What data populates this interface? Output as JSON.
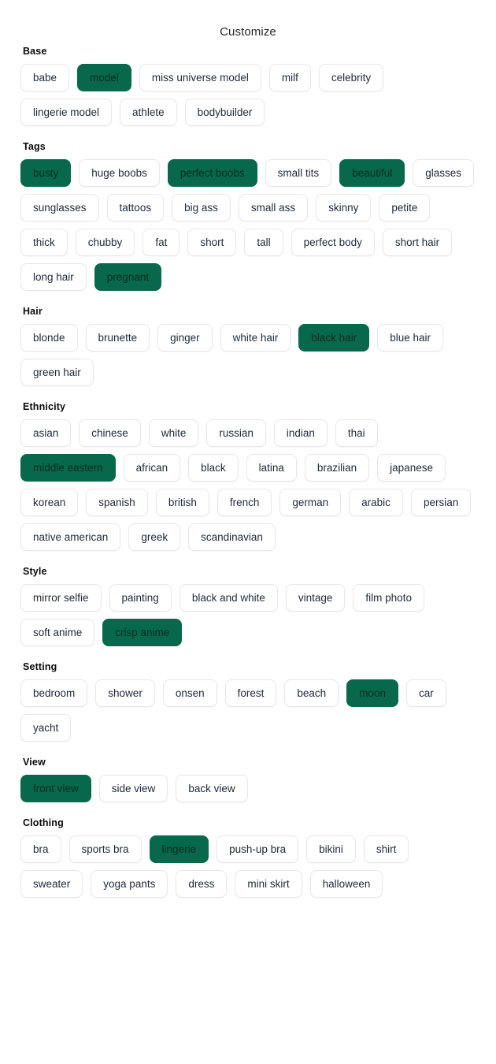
{
  "panel": {
    "title": "Customize",
    "accent_selected_bg": "#07684B",
    "accent_selected_text": "#0c2b20",
    "pill_bg": "#ffffff",
    "pill_border": "#e7e7ea",
    "pill_text": "#1f2937"
  },
  "sections": [
    {
      "label": "Base",
      "options": [
        {
          "label": "babe",
          "selected": false
        },
        {
          "label": "model",
          "selected": true
        },
        {
          "label": "miss universe model",
          "selected": false
        },
        {
          "label": "milf",
          "selected": false
        },
        {
          "label": "celebrity",
          "selected": false
        },
        {
          "label": "lingerie model",
          "selected": false
        },
        {
          "label": "athlete",
          "selected": false
        },
        {
          "label": "bodybuilder",
          "selected": false
        }
      ]
    },
    {
      "label": "Tags",
      "options": [
        {
          "label": "busty",
          "selected": true
        },
        {
          "label": "huge boobs",
          "selected": false
        },
        {
          "label": "perfect boobs",
          "selected": true
        },
        {
          "label": "small tits",
          "selected": false
        },
        {
          "label": "beautiful",
          "selected": true
        },
        {
          "label": "glasses",
          "selected": false
        },
        {
          "label": "sunglasses",
          "selected": false
        },
        {
          "label": "tattoos",
          "selected": false
        },
        {
          "label": "big ass",
          "selected": false
        },
        {
          "label": "small ass",
          "selected": false
        },
        {
          "label": "skinny",
          "selected": false
        },
        {
          "label": "petite",
          "selected": false
        },
        {
          "label": "thick",
          "selected": false
        },
        {
          "label": "chubby",
          "selected": false
        },
        {
          "label": "fat",
          "selected": false
        },
        {
          "label": "short",
          "selected": false
        },
        {
          "label": "tall",
          "selected": false
        },
        {
          "label": "perfect body",
          "selected": false
        },
        {
          "label": "short hair",
          "selected": false
        },
        {
          "label": "long hair",
          "selected": false
        },
        {
          "label": "pregnant",
          "selected": true
        }
      ]
    },
    {
      "label": "Hair",
      "options": [
        {
          "label": "blonde",
          "selected": false
        },
        {
          "label": "brunette",
          "selected": false
        },
        {
          "label": "ginger",
          "selected": false
        },
        {
          "label": "white hair",
          "selected": false
        },
        {
          "label": "black hair",
          "selected": true
        },
        {
          "label": "blue hair",
          "selected": false
        },
        {
          "label": "green hair",
          "selected": false
        }
      ]
    },
    {
      "label": "Ethnicity",
      "options": [
        {
          "label": "asian",
          "selected": false
        },
        {
          "label": "chinese",
          "selected": false
        },
        {
          "label": "white",
          "selected": false
        },
        {
          "label": "russian",
          "selected": false
        },
        {
          "label": "indian",
          "selected": false
        },
        {
          "label": "thai",
          "selected": false
        },
        {
          "label": "middle eastern",
          "selected": true
        },
        {
          "label": "african",
          "selected": false
        },
        {
          "label": "black",
          "selected": false
        },
        {
          "label": "latina",
          "selected": false
        },
        {
          "label": "brazilian",
          "selected": false
        },
        {
          "label": "japanese",
          "selected": false
        },
        {
          "label": "korean",
          "selected": false
        },
        {
          "label": "spanish",
          "selected": false
        },
        {
          "label": "british",
          "selected": false
        },
        {
          "label": "french",
          "selected": false
        },
        {
          "label": "german",
          "selected": false
        },
        {
          "label": "arabic",
          "selected": false
        },
        {
          "label": "persian",
          "selected": false
        },
        {
          "label": "native american",
          "selected": false
        },
        {
          "label": "greek",
          "selected": false
        },
        {
          "label": "scandinavian",
          "selected": false
        }
      ]
    },
    {
      "label": "Style",
      "options": [
        {
          "label": "mirror selfie",
          "selected": false
        },
        {
          "label": "painting",
          "selected": false
        },
        {
          "label": "black and white",
          "selected": false
        },
        {
          "label": "vintage",
          "selected": false
        },
        {
          "label": "film photo",
          "selected": false
        },
        {
          "label": "soft anime",
          "selected": false
        },
        {
          "label": "crisp anime",
          "selected": true
        }
      ]
    },
    {
      "label": "Setting",
      "options": [
        {
          "label": "bedroom",
          "selected": false
        },
        {
          "label": "shower",
          "selected": false
        },
        {
          "label": "onsen",
          "selected": false
        },
        {
          "label": "forest",
          "selected": false
        },
        {
          "label": "beach",
          "selected": false
        },
        {
          "label": "moon",
          "selected": true
        },
        {
          "label": "car",
          "selected": false
        },
        {
          "label": "yacht",
          "selected": false
        }
      ]
    },
    {
      "label": "View",
      "options": [
        {
          "label": "front view",
          "selected": true
        },
        {
          "label": "side view",
          "selected": false
        },
        {
          "label": "back view",
          "selected": false
        }
      ]
    },
    {
      "label": "Clothing",
      "options": [
        {
          "label": "bra",
          "selected": false
        },
        {
          "label": "sports bra",
          "selected": false
        },
        {
          "label": "lingerie",
          "selected": true
        },
        {
          "label": "push-up bra",
          "selected": false
        },
        {
          "label": "bikini",
          "selected": false
        },
        {
          "label": "shirt",
          "selected": false
        },
        {
          "label": "sweater",
          "selected": false
        },
        {
          "label": "yoga pants",
          "selected": false
        },
        {
          "label": "dress",
          "selected": false
        },
        {
          "label": "mini skirt",
          "selected": false
        },
        {
          "label": "halloween",
          "selected": false
        }
      ]
    }
  ]
}
